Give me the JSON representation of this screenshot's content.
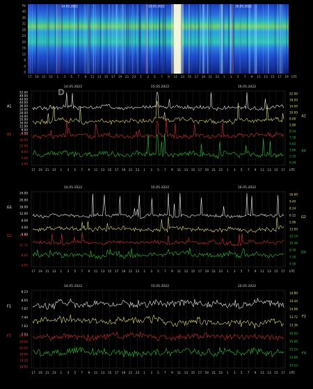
{
  "spectrogram": {
    "top_dates": [
      "14.05.2022",
      "15.05.2022",
      "16.05.2022"
    ],
    "y_ticks": [
      "Hz",
      "40",
      "36",
      "32",
      "28",
      "24",
      "20",
      "16",
      "12",
      "8",
      "4",
      "0"
    ],
    "x_ticks": [
      "17",
      "19",
      "21",
      "23",
      "1",
      "3",
      "5",
      "7",
      "9",
      "11",
      "13",
      "15",
      "17",
      "19",
      "21",
      "23",
      "1",
      "3",
      "5",
      "7",
      "9",
      "11",
      "13",
      "15",
      "17",
      "19",
      "21",
      "23",
      "1",
      "3",
      "5",
      "7",
      "9",
      "11",
      "13",
      "15",
      "17",
      "19"
    ],
    "unit": "UTC"
  },
  "watermark": "D",
  "dates": [
    "14.05.2022",
    "15.05.2022",
    "16.05.2022"
  ],
  "x_ticks": [
    "17",
    "19",
    "21",
    "23",
    "1",
    "3",
    "5",
    "7",
    "9",
    "11",
    "13",
    "15",
    "17",
    "19",
    "21",
    "23",
    "1",
    "3",
    "5",
    "7",
    "9",
    "11",
    "13",
    "15",
    "17",
    "19",
    "21",
    "23",
    "1",
    "3",
    "5",
    "7",
    "9",
    "11",
    "13",
    "15",
    "17"
  ],
  "x_unit": "UTC",
  "colors": {
    "white": "#f4f4f4",
    "yellow": "#e8e07a",
    "red": "#d83030",
    "green": "#2ec43a"
  },
  "chart_data": [
    {
      "type": "line",
      "left_labels": [
        "A1",
        "A2"
      ],
      "right_labels": [
        "A2",
        "A4"
      ],
      "left_ticks_white": [
        "52.00",
        "48.00",
        "44.00",
        "40.00",
        "36.00",
        "32.00",
        "28.00",
        "24.00",
        "20.00",
        "16.00",
        "12.00",
        "8.00",
        "4.00"
      ],
      "left_ticks_red": [
        "20.00",
        "16.00",
        "12.00",
        "8.00",
        "4.00",
        "0.00"
      ],
      "right_ticks": [
        "22.00",
        "18.00",
        "14.00",
        "10.00",
        "6.00",
        "2.80",
        "8.14",
        "7.38",
        "5.62",
        "3.86",
        "2.10",
        "0.34"
      ],
      "series": [
        {
          "color": "white",
          "base": 0.22,
          "amp": 0.045,
          "spike": 0.3,
          "seed": 11
        },
        {
          "color": "yellow",
          "base": 0.4,
          "amp": 0.05,
          "spike": 0.25,
          "seed": 23
        },
        {
          "color": "red",
          "base": 0.6,
          "amp": 0.05,
          "spike": 0.22,
          "seed": 37
        },
        {
          "color": "green",
          "base": 0.85,
          "amp": 0.06,
          "spike": 0.3,
          "seed": 41
        }
      ]
    },
    {
      "type": "line",
      "left_labels": [
        "G1",
        "G2"
      ],
      "right_labels": [
        "G2",
        "G4"
      ],
      "left_ticks_white": [
        "24.00",
        "20.00",
        "16.00",
        "12.00",
        "8.00",
        "4.00",
        "0.00"
      ],
      "left_ticks_red": [
        "15.40",
        "11.72",
        "8.00",
        "4.00"
      ],
      "right_ticks": [
        "16.60",
        "9.40",
        "8.24",
        "6.12",
        "5.90",
        "13.00",
        "12.14",
        "10.46",
        "8.78",
        "7.10",
        "5.50"
      ],
      "series": [
        {
          "color": "white",
          "base": 0.32,
          "amp": 0.035,
          "spike": 0.32,
          "seed": 53
        },
        {
          "color": "yellow",
          "base": 0.5,
          "amp": 0.05,
          "spike": 0.18,
          "seed": 61
        },
        {
          "color": "red",
          "base": 0.68,
          "amp": 0.04,
          "spike": 0.15,
          "seed": 71
        },
        {
          "color": "green",
          "base": 0.84,
          "amp": 0.05,
          "spike": 0.1,
          "seed": 83
        }
      ]
    },
    {
      "type": "line",
      "left_labels": [
        "F1",
        "F3"
      ],
      "right_labels": [
        "F2",
        "F4"
      ],
      "left_ticks_white": [
        "8.23",
        "8.05",
        "7.67",
        "7.44",
        "7.63",
        "7.03"
      ],
      "left_ticks_red": [
        "20.80",
        "20.40",
        "20.00",
        "19.60",
        "19.20",
        "18.80"
      ],
      "right_ticks": [
        "14.80",
        "14.44",
        "14.08",
        "13.72",
        "13.36",
        "26.00",
        "25.60",
        "25.24",
        "24.88",
        "24.52"
      ],
      "series": [
        {
          "color": "white",
          "base": 0.18,
          "amp": 0.07,
          "spike": 0.05,
          "seed": 97
        },
        {
          "color": "yellow",
          "base": 0.4,
          "amp": 0.07,
          "spike": 0.05,
          "seed": 101
        },
        {
          "color": "red",
          "base": 0.6,
          "amp": 0.06,
          "spike": 0.04,
          "seed": 113
        },
        {
          "color": "green",
          "base": 0.8,
          "amp": 0.07,
          "spike": 0.04,
          "seed": 127
        }
      ]
    }
  ]
}
